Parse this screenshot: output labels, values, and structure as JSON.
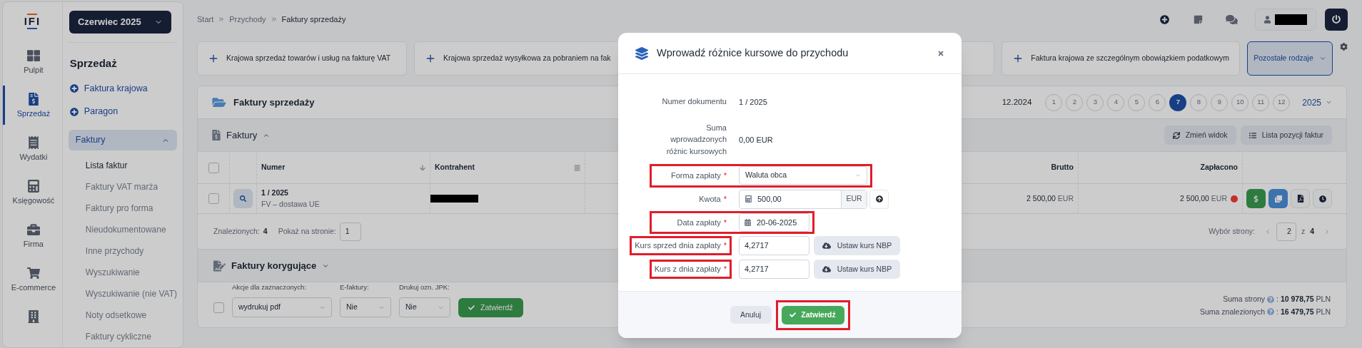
{
  "sidebar": {
    "logo": "IFI",
    "month_button": "Czerwiec 2025",
    "rail": [
      {
        "kind": "dashboard",
        "label": "Pulpit",
        "selected": false
      },
      {
        "kind": "sales",
        "label": "Sprzedaż",
        "selected": true
      },
      {
        "kind": "expenses",
        "label": "Wydatki",
        "selected": false
      },
      {
        "kind": "accounting",
        "label": "Księgowość",
        "selected": false
      },
      {
        "kind": "company",
        "label": "Firma",
        "selected": false
      },
      {
        "kind": "cart",
        "label": "E-commerce",
        "selected": false
      },
      {
        "kind": "building",
        "selected": false
      }
    ],
    "section_title": "Sprzedaż",
    "quick_links": [
      "Faktura krajowa",
      "Paragon"
    ],
    "group": {
      "label": "Faktury",
      "expanded": true,
      "items": [
        {
          "label": "Lista faktur",
          "selected": true
        },
        {
          "label": "Faktury VAT marża",
          "selected": false
        },
        {
          "label": "Faktury pro forma",
          "selected": false
        },
        {
          "label": "Nieudokumentowane",
          "selected": false
        },
        {
          "label": "Inne przychody",
          "selected": false
        },
        {
          "label": "Wyszukiwanie",
          "selected": false
        },
        {
          "label": "Wyszukiwanie (nie VAT)",
          "selected": false
        },
        {
          "label": "Noty odsetkowe",
          "selected": false
        },
        {
          "label": "Faktury cykliczne",
          "selected": false
        }
      ]
    }
  },
  "breadcrumb": [
    "Start",
    "Przychody",
    "Faktury sprzedaży"
  ],
  "quick_add": [
    "Krajowa sprzedaż towarów i usług na fakturę VAT",
    "Krajowa sprzedaż wysyłkowa za pobraniem na fak",
    "Faktura krajowa ze szczególnym obowiązkiem podatkowym"
  ],
  "more_button": "Pozostałe rodzaje",
  "invoices": {
    "title": "Faktury sprzedaży",
    "period": "12.2024",
    "months": [
      {
        "label": "1",
        "selected": false
      },
      {
        "label": "2",
        "selected": false
      },
      {
        "label": "3",
        "selected": false
      },
      {
        "label": "4",
        "selected": false
      },
      {
        "label": "5",
        "selected": false
      },
      {
        "label": "6",
        "selected": false
      },
      {
        "label": "7",
        "selected": true
      },
      {
        "label": "8",
        "selected": false
      },
      {
        "label": "9",
        "selected": false
      },
      {
        "label": "10",
        "selected": false
      },
      {
        "label": "11",
        "selected": false
      },
      {
        "label": "12",
        "selected": false
      }
    ],
    "year": "2025",
    "section": {
      "title": "Faktury",
      "expanded": true
    },
    "view_buttons": [
      "Zmień widok",
      "Lista pozycji faktur"
    ],
    "select_all_checked": false,
    "columns": {
      "number": "Numer",
      "contractor": "Kontrahent",
      "gross": "Brutto",
      "paid": "Zapłacono"
    },
    "rows": [
      {
        "checked": false,
        "number": "1 / 2025",
        "type": "FV – dostawa UE",
        "gross": "2 500,00",
        "gross_currency": "EUR",
        "paid": "2 500,00",
        "paid_currency": "EUR",
        "color": "#c4302b"
      }
    ],
    "found_label": "Znalezionych:",
    "found": "4",
    "per_page_label": "Pokaż na stronie:",
    "per_page": "1",
    "page_label": "Wybór strony:",
    "page": "2",
    "page_of": "z",
    "pages": "4",
    "corrections": {
      "title": "Faktury korygujące",
      "expanded": false
    },
    "bulk": {
      "checked": false,
      "fields": [
        {
          "label": "Akcje dla zaznaczonych:",
          "value": "wydrukuj pdf"
        },
        {
          "label": "E-faktury:",
          "value": "Nie"
        },
        {
          "label": "Drukuj ozn. JPK:",
          "value": "Nie"
        }
      ],
      "confirm": "Zatwierdź"
    },
    "sums": [
      {
        "label": "Suma strony",
        "separator": ":",
        "value": "10 978,75",
        "currency": "PLN"
      },
      {
        "label": "Suma znalezionych",
        "separator": ":",
        "value": "16 479,75",
        "currency": "PLN"
      }
    ]
  },
  "modal": {
    "title": "Wprowadź różnice kursowe do przychodu",
    "rows": [
      {
        "kind": "text",
        "label": "Numer dokumentu",
        "value": "1 / 2025",
        "highlighted": false,
        "label_highlighted": false
      },
      {
        "kind": "text",
        "label": "Suma wprowadzonych różnic kursowych",
        "value": "0,00 EUR",
        "highlighted": false,
        "label_highlighted": false
      },
      {
        "kind": "select",
        "label": "Forma zapłaty",
        "mark": "*",
        "value": "Waluta obca",
        "highlighted": true,
        "label_highlighted": false
      },
      {
        "kind": "amount",
        "label": "Kwota",
        "mark": "*",
        "value": "500,00",
        "unit": "EUR",
        "highlighted": false,
        "label_highlighted": false
      },
      {
        "kind": "date",
        "label": "Data zapłaty",
        "mark": "*",
        "value": "20-06-2025",
        "highlighted": true,
        "label_highlighted": false
      },
      {
        "kind": "rate",
        "label": "Kurs sprzed dnia zapłaty",
        "mark": "*",
        "value": "4,2717",
        "button": "Ustaw kurs NBP",
        "highlighted": false,
        "label_highlighted": true
      },
      {
        "kind": "rate",
        "label": "Kurs z dnia zapłaty",
        "mark": "*",
        "value": "4,2717",
        "button": "Ustaw kurs NBP",
        "highlighted": false,
        "label_highlighted": true
      }
    ],
    "cancel": "Anuluj",
    "confirm": {
      "label": "Zatwierdź",
      "highlighted": true
    }
  }
}
